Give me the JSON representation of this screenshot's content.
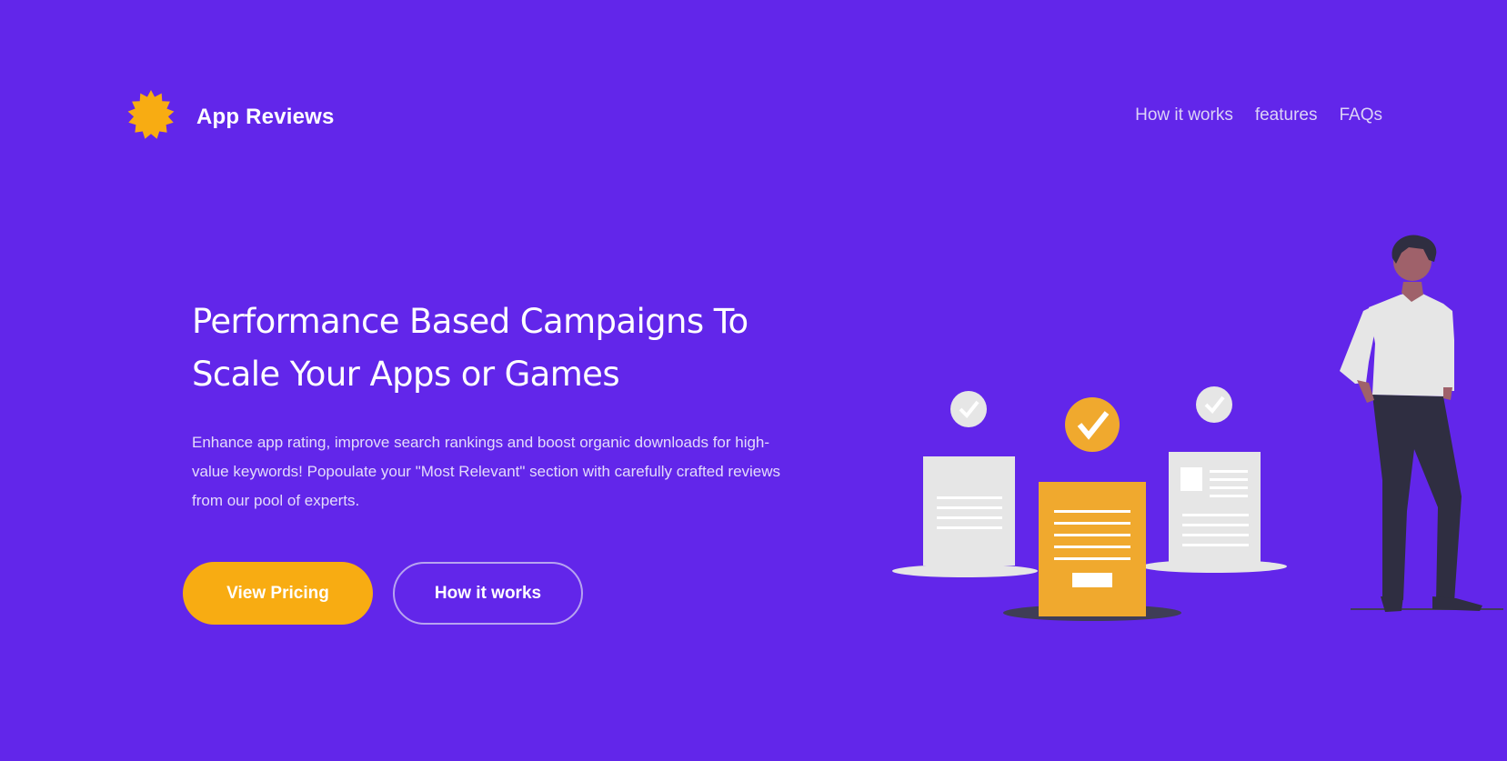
{
  "header": {
    "logo_text": "App Reviews",
    "logo_icon": "sun-badge-icon",
    "nav": [
      {
        "label": "How it works"
      },
      {
        "label": "features"
      },
      {
        "label": "FAQs"
      }
    ]
  },
  "hero": {
    "title_line1": "Performance Based Campaigns To",
    "title_line2": "Scale Your Apps or Games",
    "description": "Enhance app rating, improve search rankings and boost organic downloads for high-value keywords! Popoulate your \"Most Relevant\" section with carefully crafted reviews from our pool of experts.",
    "primary_button": "View Pricing",
    "secondary_button": "How it works"
  },
  "colors": {
    "background": "#6226ea",
    "accent": "#f8ac12",
    "document_gray": "#e6e6e6",
    "document_orange": "#f0a92e",
    "figure_dark": "#2f2e41"
  },
  "illustration": {
    "icon": "review-documents-illustration"
  }
}
